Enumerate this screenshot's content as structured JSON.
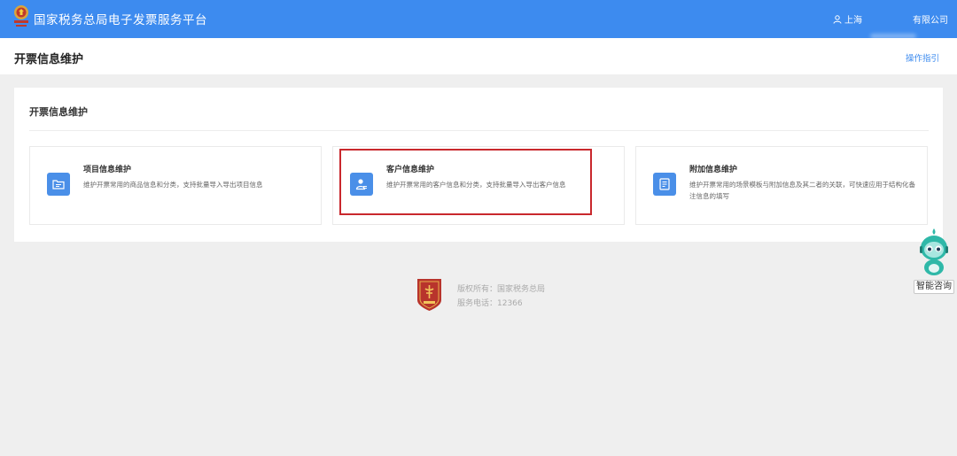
{
  "header": {
    "app_title": "国家税务总局电子发票服务平台",
    "user_location": "上海",
    "company_name": "有限公司"
  },
  "subheader": {
    "page_title": "开票信息维护",
    "guide_link": "操作指引"
  },
  "panel": {
    "title": "开票信息维护",
    "cards": [
      {
        "title": "项目信息维护",
        "description": "维护开票常用的商品信息和分类，支持批量导入导出项目信息",
        "icon": "folder-list-icon"
      },
      {
        "title": "客户信息维护",
        "description": "维护开票常用的客户信息和分类，支持批量导入导出客户信息",
        "icon": "customer-card-icon"
      },
      {
        "title": "附加信息维护",
        "description": "维护开票常用的场景模板与附加信息及其二者的关联，可快速应用于结构化备注信息的填写",
        "icon": "document-edit-icon"
      }
    ]
  },
  "footer": {
    "copyright": "版权所有：国家税务总局",
    "service_phone": "服务电话：12366"
  },
  "assistant": {
    "label": "智能咨询"
  },
  "colors": {
    "header_bg": "#3d8bef",
    "accent": "#4a8fe8",
    "highlight": "#c9282d",
    "page_bg": "#efefef"
  }
}
